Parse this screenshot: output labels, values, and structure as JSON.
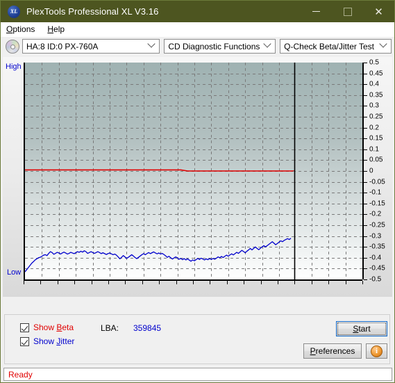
{
  "window": {
    "title": "PlexTools Professional XL V3.16",
    "app_icon": "XL",
    "minimize": "—",
    "maximize": "",
    "close": "✕"
  },
  "menu": [
    {
      "label": "Options",
      "accel": "O"
    },
    {
      "label": "Help",
      "accel": "H"
    }
  ],
  "toolbar": {
    "drive_select": "HA:8 ID:0  PX-760A",
    "function_select": "CD Diagnostic Functions",
    "test_select": "Q-Check Beta/Jitter Test"
  },
  "graph": {
    "high_label": "High",
    "low_label": "Low"
  },
  "controls": {
    "show_beta_label": "Show Beta",
    "show_beta_accel": "B",
    "show_beta_checked": true,
    "show_jitter_label": "Show Jitter",
    "show_jitter_accel": "J",
    "show_jitter_checked": true,
    "lba_label": "LBA:",
    "lba_value": "359845",
    "start_label": "Start",
    "start_accel": "S",
    "preferences_label": "Preferences",
    "preferences_accel": "P",
    "info_icon": "i"
  },
  "status": {
    "text": "Ready"
  },
  "colors": {
    "titlebar": "#4d5520",
    "beta_line": "#e00000",
    "jitter_line": "#0000cd",
    "accent_focus": "#1268c8",
    "status_text": "#e00000"
  },
  "chart_data": {
    "type": "line",
    "title": "Q-Check Beta/Jitter Test",
    "xlabel": "",
    "ylabel": "",
    "xlim": [
      0,
      100
    ],
    "ylim": [
      -0.5,
      0.5
    ],
    "xticks": [
      0,
      5,
      10,
      15,
      20,
      25,
      30,
      35,
      40,
      45,
      50,
      55,
      60,
      65,
      70,
      75,
      80,
      85,
      90,
      95,
      100
    ],
    "yticks": [
      0.5,
      0.45,
      0.4,
      0.35,
      0.3,
      0.25,
      0.2,
      0.15,
      0.1,
      0.05,
      0,
      -0.05,
      -0.1,
      -0.15,
      -0.2,
      -0.25,
      -0.3,
      -0.35,
      -0.4,
      -0.45,
      -0.5
    ],
    "grid": true,
    "legend": [
      "Show Beta",
      "Show Jitter"
    ],
    "legend_position": "bottom-left",
    "data_end_marker_x": 80,
    "series": [
      {
        "name": "Beta",
        "color": "#e00000",
        "x": [
          0,
          2,
          4,
          6,
          8,
          10,
          12,
          14,
          16,
          18,
          20,
          22,
          24,
          26,
          28,
          30,
          32,
          34,
          36,
          38,
          40,
          42,
          44,
          46,
          48,
          50,
          52,
          54,
          56,
          58,
          60,
          62,
          64,
          66,
          68,
          70,
          72,
          74,
          76,
          78,
          80
        ],
        "values": [
          0.005,
          0.005,
          0.005,
          0.005,
          0.005,
          0.005,
          0.005,
          0.005,
          0.005,
          0.005,
          0.005,
          0.005,
          0.005,
          0.005,
          0.005,
          0.005,
          0.005,
          0.005,
          0.005,
          0.005,
          0.005,
          0.005,
          0.005,
          0.005,
          0.0,
          0.0,
          0.0,
          0.0,
          0.0,
          0.0,
          0.0,
          0.0,
          0.0,
          0.0,
          0.0,
          0.0,
          0.0,
          0.0,
          0.0,
          0.0,
          0.0
        ]
      },
      {
        "name": "Jitter",
        "color": "#0000cd",
        "x": [
          0,
          0.5,
          1,
          1.5,
          2,
          2.5,
          3,
          3.5,
          4,
          4.5,
          5,
          5.5,
          6,
          6.5,
          7,
          7.5,
          8,
          8.5,
          9,
          9.5,
          10,
          10.5,
          11,
          11.5,
          12,
          12.5,
          13,
          13.5,
          14,
          14.5,
          15,
          15.5,
          16,
          16.5,
          17,
          17.5,
          18,
          18.5,
          19,
          19.5,
          20,
          20.5,
          21,
          21.5,
          22,
          22.5,
          23,
          23.5,
          24,
          24.5,
          25,
          25.5,
          26,
          26.5,
          27,
          27.5,
          28,
          28.5,
          29,
          29.5,
          30,
          30.5,
          31,
          31.5,
          32,
          32.5,
          33,
          33.5,
          34,
          34.5,
          35,
          35.5,
          36,
          36.5,
          37,
          37.5,
          38,
          38.5,
          39,
          39.5,
          40,
          40.5,
          41,
          41.5,
          42,
          42.5,
          43,
          43.5,
          44,
          44.5,
          45,
          45.5,
          46,
          46.5,
          47,
          47.5,
          48,
          48.5,
          49,
          49.5,
          50,
          50.5,
          51,
          51.5,
          52,
          52.5,
          53,
          53.5,
          54,
          54.5,
          55,
          55.5,
          56,
          56.5,
          57,
          57.5,
          58,
          58.5,
          59,
          59.5,
          60,
          60.5,
          61,
          61.5,
          62,
          62.5,
          63,
          63.5,
          64,
          64.5,
          65,
          65.5,
          66,
          66.5,
          67,
          67.5,
          68,
          68.5,
          69,
          69.5,
          70,
          70.5,
          71,
          71.5,
          72,
          72.5,
          73,
          73.5,
          74,
          74.5,
          75,
          75.5,
          76,
          76.5,
          77,
          77.5,
          78,
          78.5,
          79,
          79.5,
          80
        ],
        "values": [
          -0.465,
          -0.455,
          -0.445,
          -0.435,
          -0.425,
          -0.418,
          -0.41,
          -0.405,
          -0.4,
          -0.398,
          -0.393,
          -0.388,
          -0.386,
          -0.39,
          -0.38,
          -0.372,
          -0.376,
          -0.384,
          -0.38,
          -0.375,
          -0.378,
          -0.383,
          -0.378,
          -0.374,
          -0.378,
          -0.383,
          -0.38,
          -0.375,
          -0.378,
          -0.381,
          -0.377,
          -0.372,
          -0.375,
          -0.37,
          -0.374,
          -0.368,
          -0.372,
          -0.38,
          -0.376,
          -0.372,
          -0.376,
          -0.38,
          -0.376,
          -0.372,
          -0.376,
          -0.381,
          -0.377,
          -0.381,
          -0.385,
          -0.381,
          -0.378,
          -0.382,
          -0.386,
          -0.383,
          -0.388,
          -0.396,
          -0.405,
          -0.398,
          -0.39,
          -0.396,
          -0.403,
          -0.398,
          -0.392,
          -0.386,
          -0.392,
          -0.399,
          -0.404,
          -0.398,
          -0.392,
          -0.386,
          -0.381,
          -0.386,
          -0.381,
          -0.376,
          -0.381,
          -0.377,
          -0.373,
          -0.378,
          -0.382,
          -0.378,
          -0.383,
          -0.38,
          -0.385,
          -0.391,
          -0.398,
          -0.393,
          -0.4,
          -0.406,
          -0.401,
          -0.396,
          -0.401,
          -0.407,
          -0.403,
          -0.409,
          -0.404,
          -0.41,
          -0.405,
          -0.411,
          -0.416,
          -0.41,
          -0.414,
          -0.409,
          -0.403,
          -0.408,
          -0.402,
          -0.406,
          -0.41,
          -0.405,
          -0.409,
          -0.404,
          -0.408,
          -0.403,
          -0.407,
          -0.402,
          -0.396,
          -0.4,
          -0.394,
          -0.399,
          -0.393,
          -0.388,
          -0.393,
          -0.387,
          -0.382,
          -0.387,
          -0.381,
          -0.375,
          -0.38,
          -0.373,
          -0.366,
          -0.371,
          -0.377,
          -0.37,
          -0.364,
          -0.357,
          -0.364,
          -0.357,
          -0.35,
          -0.357,
          -0.363,
          -0.356,
          -0.35,
          -0.344,
          -0.35,
          -0.344,
          -0.338,
          -0.332,
          -0.326,
          -0.333,
          -0.34,
          -0.334,
          -0.328,
          -0.322,
          -0.326,
          -0.32,
          -0.316,
          -0.312,
          -0.316,
          -0.31
        ]
      }
    ]
  }
}
